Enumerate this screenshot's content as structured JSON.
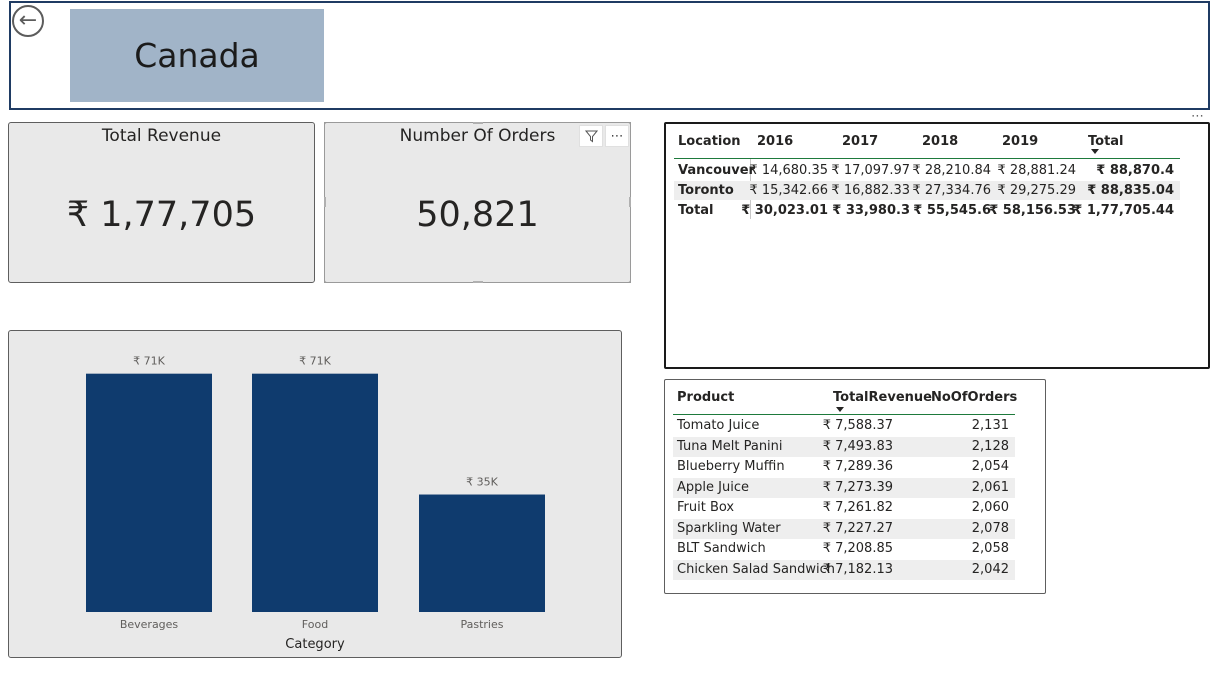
{
  "header": {
    "back_icon": "arrow-left-circle-icon",
    "title": "Canada"
  },
  "cards": {
    "revenue": {
      "title": "Total Revenue",
      "value": "₹ 1,77,705"
    },
    "orders": {
      "title": "Number Of Orders",
      "value": "50,821",
      "filter_icon": "filter-icon",
      "more_icon": "more-options-icon"
    }
  },
  "matrix": {
    "more_icon": "more-options-icon",
    "columns": [
      "Location",
      "2016",
      "2017",
      "2018",
      "2019",
      "Total"
    ],
    "rows": [
      {
        "location": "Vancouver",
        "values": [
          "₹ 14,680.35",
          "₹ 17,097.97",
          "₹ 28,210.84",
          "₹ 28,881.24",
          "₹ 88,870.4"
        ]
      },
      {
        "location": "Toronto",
        "values": [
          "₹ 15,342.66",
          "₹ 16,882.33",
          "₹ 27,334.76",
          "₹ 29,275.29",
          "₹ 88,835.04"
        ]
      }
    ],
    "total_row": {
      "location": "Total",
      "values": [
        "₹ 30,023.01",
        "₹ 33,980.3",
        "₹ 55,545.6",
        "₹ 58,156.53",
        "₹ 1,77,705.44"
      ]
    }
  },
  "product_table": {
    "columns": [
      "Product",
      "TotalRevenue",
      "NoOfOrders"
    ],
    "sort_icon": "sort-descending-icon",
    "rows": [
      {
        "product": "Tomato Juice",
        "revenue": "₹ 7,588.37",
        "orders": "2,131"
      },
      {
        "product": "Tuna Melt Panini",
        "revenue": "₹ 7,493.83",
        "orders": "2,128"
      },
      {
        "product": "Blueberry Muffin",
        "revenue": "₹ 7,289.36",
        "orders": "2,054"
      },
      {
        "product": "Apple Juice",
        "revenue": "₹ 7,273.39",
        "orders": "2,061"
      },
      {
        "product": "Fruit Box",
        "revenue": "₹ 7,261.82",
        "orders": "2,060"
      },
      {
        "product": "Sparkling Water",
        "revenue": "₹ 7,227.27",
        "orders": "2,078"
      },
      {
        "product": "BLT Sandwich",
        "revenue": "₹ 7,208.85",
        "orders": "2,058"
      },
      {
        "product": "Chicken Salad Sandwich",
        "revenue": "₹ 7,182.13",
        "orders": "2,042"
      }
    ]
  },
  "chart_data": {
    "type": "bar",
    "categories": [
      "Beverages",
      "Food",
      "Pastries"
    ],
    "values": [
      71,
      71,
      35
    ],
    "data_labels": [
      "₹ 71K",
      "₹ 71K",
      "₹ 35K"
    ],
    "xlabel": "Category",
    "ylabel": "",
    "ylim": [
      0,
      71.5
    ],
    "bar_color": "#0f3b6e",
    "grid": false
  },
  "colors": {
    "card_bg": "#e9e9e9",
    "title_tile": "#a1b4c8",
    "header_border": "#1f3b63",
    "bar": "#0f3b6e"
  }
}
